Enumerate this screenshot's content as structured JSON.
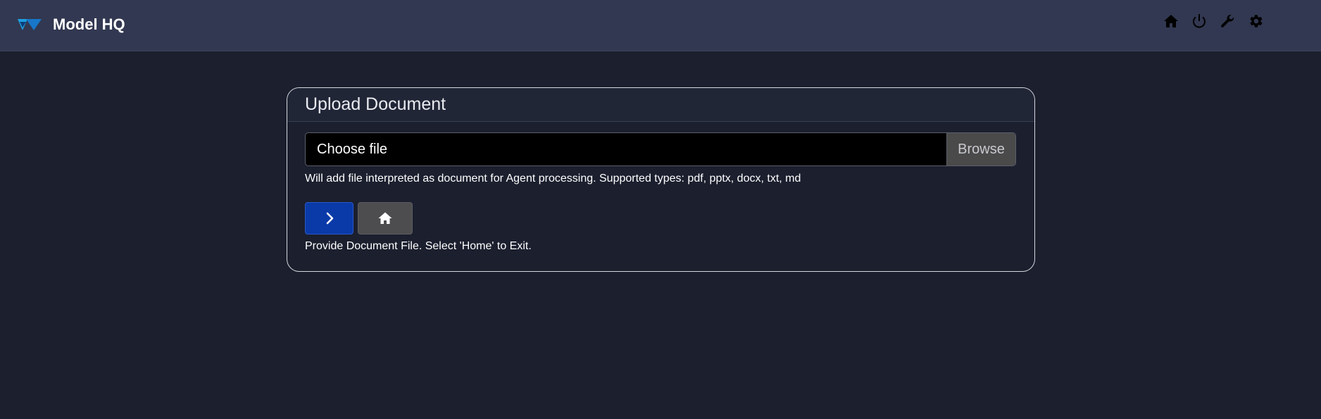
{
  "app": {
    "title": "Model HQ"
  },
  "nav": {
    "icons": [
      "home-icon",
      "power-icon",
      "wrench-icon",
      "gear-icon"
    ]
  },
  "upload": {
    "title": "Upload Document",
    "file_placeholder": "Choose file",
    "browse_label": "Browse",
    "help_text": "Will add file interpreted as document for Agent processing. Supported types: pdf, pptx, docx, txt, md",
    "status_text": "Provide Document File. Select 'Home' to Exit."
  },
  "colors": {
    "background": "#1b1f2e",
    "topbar": "#323851",
    "primary_button": "#0a3aa8",
    "secondary_button": "#4d4d4f",
    "logo_accent": "#1e9fe0"
  }
}
